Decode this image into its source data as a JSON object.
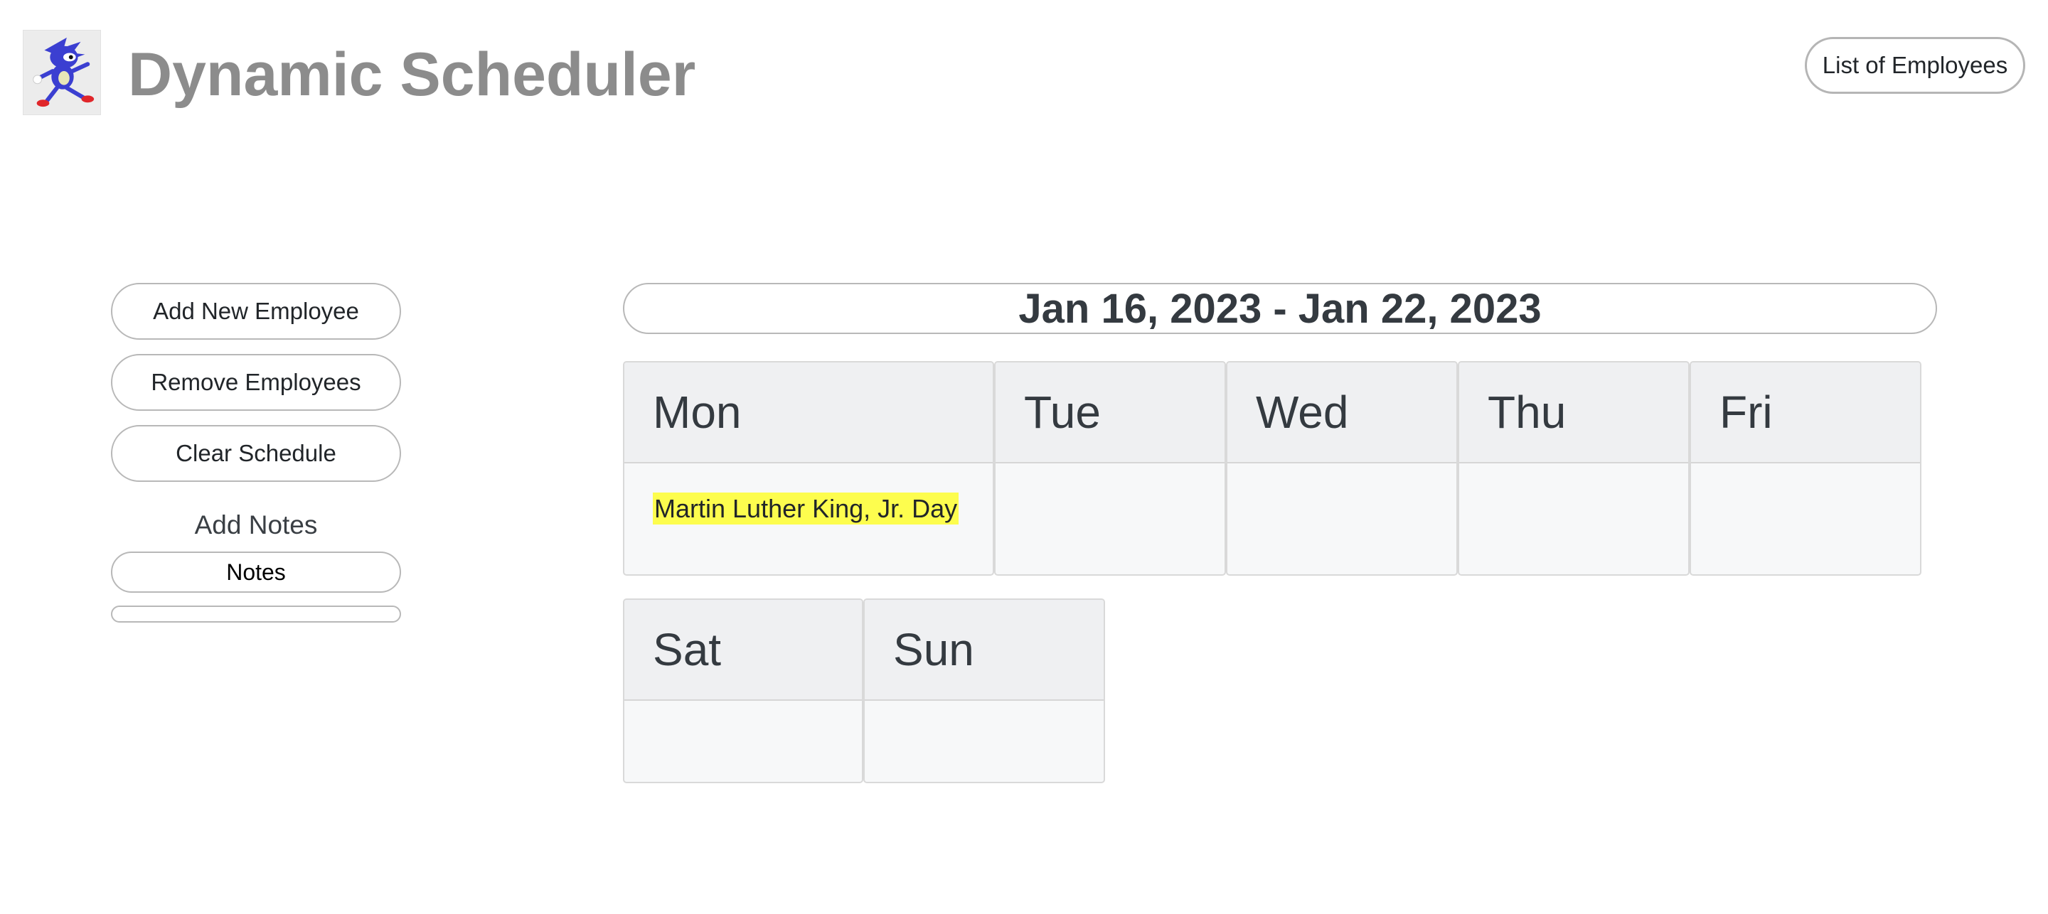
{
  "header": {
    "title": "Dynamic Scheduler",
    "list_button_label": "List of Employees",
    "logo_icon": "running-hedgehog-icon"
  },
  "sidebar": {
    "add_employee_label": "Add New Employee",
    "remove_employees_label": "Remove Employees",
    "clear_schedule_label": "Clear Schedule",
    "add_notes_label": "Add Notes",
    "notes_placeholder": "Notes",
    "notes_value": ""
  },
  "schedule": {
    "week_range": "Jan 16, 2023 - Jan 22, 2023",
    "days": [
      {
        "label": "Mon",
        "note": "Martin Luther King, Jr. Day"
      },
      {
        "label": "Tue",
        "note": ""
      },
      {
        "label": "Wed",
        "note": ""
      },
      {
        "label": "Thu",
        "note": ""
      },
      {
        "label": "Fri",
        "note": ""
      },
      {
        "label": "Sat",
        "note": ""
      },
      {
        "label": "Sun",
        "note": ""
      }
    ]
  },
  "colors": {
    "holiday_highlight": "#fdfd4e",
    "title_gray": "#8c8c8c",
    "header_bg": "#eff0f2",
    "body_bg": "#f7f8f9"
  }
}
